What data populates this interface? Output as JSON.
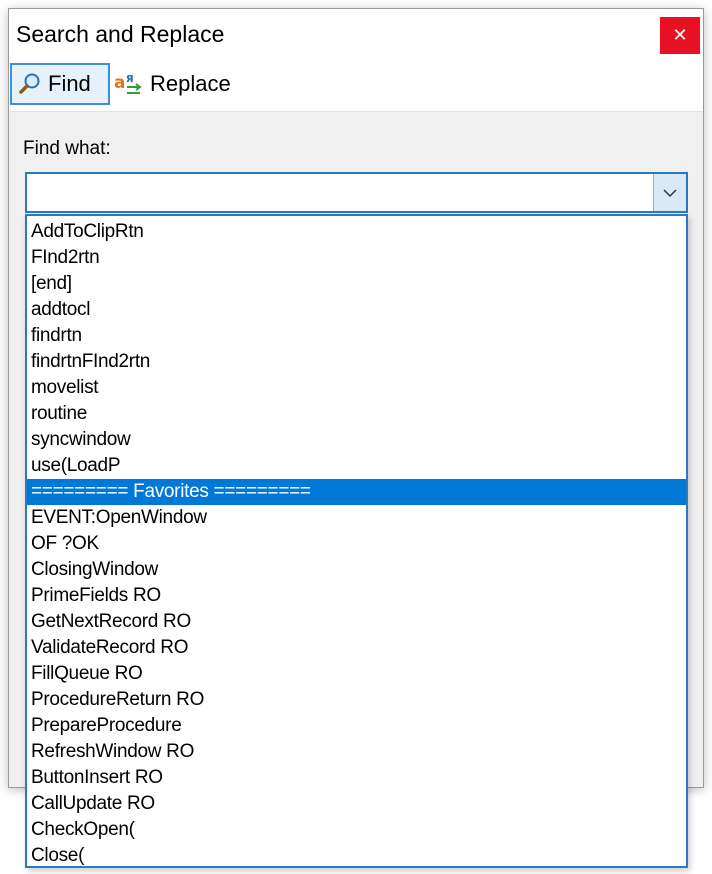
{
  "window": {
    "title": "Search and Replace",
    "close_glyph": "✕"
  },
  "toolbar": {
    "tabs": [
      {
        "label": "Find",
        "icon": "magnifier-icon",
        "active": true
      },
      {
        "label": "Replace",
        "icon": "replace-icon",
        "active": false
      }
    ]
  },
  "find": {
    "label": "Find what:",
    "value": "",
    "dropdown_icon": "chevron-down-icon"
  },
  "dropdown": {
    "selected_index": 10,
    "items": [
      "AddToClipRtn",
      "FInd2rtn",
      "[end]",
      "addtocl",
      "findrtn",
      "findrtnFInd2rtn",
      "movelist",
      "routine",
      "syncwindow",
      "use(LoadP",
      "========= Favorites =========",
      "EVENT:OpenWindow",
      "OF ?OK",
      "ClosingWindow",
      "PrimeFields RO",
      "GetNextRecord RO",
      "ValidateRecord RO",
      "FillQueue RO",
      "ProcedureReturn RO",
      "PrepareProcedure",
      "RefreshWindow RO",
      "ButtonInsert RO",
      "CallUpdate RO",
      "CheckOpen(",
      "Close("
    ]
  },
  "colors": {
    "accent": "#0078d7",
    "close_bg": "#e81123",
    "border_focus": "#2b79c2"
  }
}
